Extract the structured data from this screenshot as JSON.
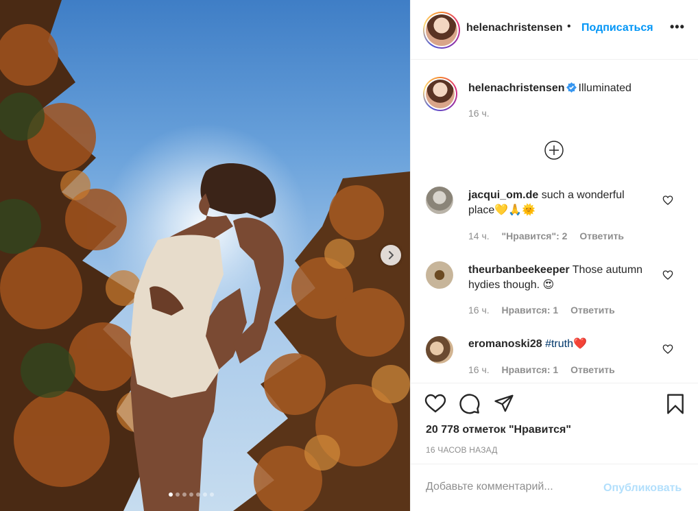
{
  "post": {
    "username": "helenachristensen",
    "follow_separator": "•",
    "follow_label": "Подписаться",
    "more_label": "•••"
  },
  "caption": {
    "username": "helenachristensen",
    "text": "Illuminated",
    "time": "16 ч."
  },
  "comments": [
    {
      "username": "jacqui_om.de",
      "text": "such a wonderful place💛🙏🌞",
      "time": "14 ч.",
      "likes": "\"Нравится\": 2",
      "reply": "Ответить"
    },
    {
      "username": "theurbanbeekeeper",
      "text": "Those autumn hydies though. 😍",
      "time": "16 ч.",
      "likes": "Нравится: 1",
      "reply": "Ответить"
    },
    {
      "username": "eromanoski28",
      "text": "#truth❤️",
      "time": "16 ч.",
      "likes": "Нравится: 1",
      "reply": "Ответить"
    }
  ],
  "stats": {
    "likes": "20 778 отметок \"Нравится\"",
    "date": "16 ЧАСОВ НАЗАД"
  },
  "comment_box": {
    "placeholder": "Добавьте комментарий...",
    "post_label": "Опубликовать"
  },
  "carousel": {
    "total": 7,
    "active": 0
  },
  "colors": {
    "link": "#0095f6",
    "muted": "#8e8e8e",
    "text": "#262626",
    "post_disabled": "#b2dffc"
  },
  "icons": [
    "plus-circle-icon",
    "heart-icon",
    "comment-icon",
    "share-icon",
    "bookmark-icon",
    "verified-badge-icon",
    "chevron-right-icon"
  ]
}
